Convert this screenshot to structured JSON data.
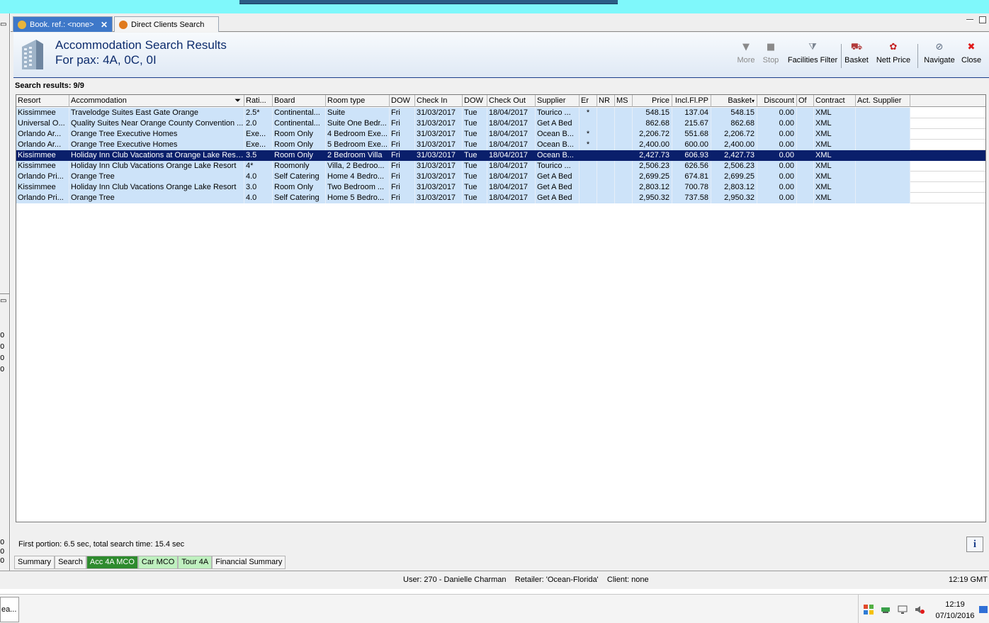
{
  "tabs": [
    {
      "label": "Book. ref.: <none>",
      "active": true
    },
    {
      "label": "Direct Clients Search",
      "active": false
    }
  ],
  "header": {
    "title": "Accommodation Search Results",
    "subtitle": "For pax: 4A, 0C, 0I"
  },
  "toolbar": {
    "more": "More",
    "stop": "Stop",
    "facilities_filter": "Facilities Filter",
    "basket": "Basket",
    "nett_price": "Nett Price",
    "navigate": "Navigate",
    "close": "Close"
  },
  "search_results_label": "Search results: 9/9",
  "columns": {
    "resort": "Resort",
    "accommodation": "Accommodation",
    "rating": "Rati...",
    "board": "Board",
    "room_type": "Room type",
    "dow_in": "DOW",
    "check_in": "Check In",
    "dow_out": "DOW",
    "check_out": "Check Out",
    "supplier": "Supplier",
    "er": "Er",
    "nr": "NR",
    "ms": "MS",
    "price": "Price",
    "incl_fl_pp": "Incl.Fl.PP",
    "basket": "Basket",
    "discount": "Discount",
    "of": "Of",
    "contract": "Contract",
    "act_supplier": "Act. Supplier"
  },
  "rows": [
    {
      "resort": "Kissimmee",
      "accommodation": "Travelodge Suites East Gate Orange",
      "rating": "2.5*",
      "board": "Continental...",
      "room_type": "Suite",
      "dow_in": "Fri",
      "check_in": "31/03/2017",
      "dow_out": "Tue",
      "check_out": "18/04/2017",
      "supplier": "Tourico ...",
      "er": "*",
      "nr": "",
      "ms": "",
      "price": "548.15",
      "incl_fl_pp": "137.04",
      "basket": "548.15",
      "discount": "0.00",
      "of": "",
      "contract": "XML",
      "act_supplier": ""
    },
    {
      "resort": "Universal O...",
      "accommodation": "Quality Suites Near Orange County Convention ...",
      "rating": "2.0",
      "board": "Continental...",
      "room_type": "Suite One Bedr...",
      "dow_in": "Fri",
      "check_in": "31/03/2017",
      "dow_out": "Tue",
      "check_out": "18/04/2017",
      "supplier": "Get A Bed",
      "er": "",
      "nr": "",
      "ms": "",
      "price": "862.68",
      "incl_fl_pp": "215.67",
      "basket": "862.68",
      "discount": "0.00",
      "of": "",
      "contract": "XML",
      "act_supplier": ""
    },
    {
      "resort": "Orlando Ar...",
      "accommodation": "Orange Tree Executive Homes",
      "rating": "Exe...",
      "board": "Room Only",
      "room_type": "4 Bedroom Exe...",
      "dow_in": "Fri",
      "check_in": "31/03/2017",
      "dow_out": "Tue",
      "check_out": "18/04/2017",
      "supplier": "Ocean B...",
      "er": "*",
      "nr": "",
      "ms": "",
      "price": "2,206.72",
      "incl_fl_pp": "551.68",
      "basket": "2,206.72",
      "discount": "0.00",
      "of": "",
      "contract": "XML",
      "act_supplier": ""
    },
    {
      "resort": "Orlando Ar...",
      "accommodation": "Orange Tree Executive Homes",
      "rating": "Exe...",
      "board": "Room Only",
      "room_type": "5 Bedroom Exe...",
      "dow_in": "Fri",
      "check_in": "31/03/2017",
      "dow_out": "Tue",
      "check_out": "18/04/2017",
      "supplier": "Ocean B...",
      "er": "*",
      "nr": "",
      "ms": "",
      "price": "2,400.00",
      "incl_fl_pp": "600.00",
      "basket": "2,400.00",
      "discount": "0.00",
      "of": "",
      "contract": "XML",
      "act_supplier": ""
    },
    {
      "resort": "Kissimmee",
      "accommodation": "Holiday Inn Club Vacations at Orange Lake Resort",
      "rating": "3.5",
      "board": "Room Only",
      "room_type": "2 Bedroom Villa",
      "dow_in": "Fri",
      "check_in": "31/03/2017",
      "dow_out": "Tue",
      "check_out": "18/04/2017",
      "supplier": "Ocean B...",
      "er": "",
      "nr": "",
      "ms": "",
      "price": "2,427.73",
      "incl_fl_pp": "606.93",
      "basket": "2,427.73",
      "discount": "0.00",
      "of": "",
      "contract": "XML",
      "act_supplier": "",
      "selected": true
    },
    {
      "resort": "Kissimmee",
      "accommodation": "Holiday Inn Club Vacations Orange Lake Resort",
      "rating": "4*",
      "board": "Roomonly",
      "room_type": "Villa, 2 Bedroo...",
      "dow_in": "Fri",
      "check_in": "31/03/2017",
      "dow_out": "Tue",
      "check_out": "18/04/2017",
      "supplier": "Tourico ...",
      "er": "",
      "nr": "",
      "ms": "",
      "price": "2,506.23",
      "incl_fl_pp": "626.56",
      "basket": "2,506.23",
      "discount": "0.00",
      "of": "",
      "contract": "XML",
      "act_supplier": ""
    },
    {
      "resort": "Orlando Pri...",
      "accommodation": "Orange Tree",
      "rating": "4.0",
      "board": "Self Catering",
      "room_type": "Home 4 Bedro...",
      "dow_in": "Fri",
      "check_in": "31/03/2017",
      "dow_out": "Tue",
      "check_out": "18/04/2017",
      "supplier": "Get A Bed",
      "er": "",
      "nr": "",
      "ms": "",
      "price": "2,699.25",
      "incl_fl_pp": "674.81",
      "basket": "2,699.25",
      "discount": "0.00",
      "of": "",
      "contract": "XML",
      "act_supplier": ""
    },
    {
      "resort": "Kissimmee",
      "accommodation": "Holiday Inn Club Vacations Orange Lake Resort",
      "rating": "3.0",
      "board": "Room Only",
      "room_type": "Two Bedroom ...",
      "dow_in": "Fri",
      "check_in": "31/03/2017",
      "dow_out": "Tue",
      "check_out": "18/04/2017",
      "supplier": "Get A Bed",
      "er": "",
      "nr": "",
      "ms": "",
      "price": "2,803.12",
      "incl_fl_pp": "700.78",
      "basket": "2,803.12",
      "discount": "0.00",
      "of": "",
      "contract": "XML",
      "act_supplier": ""
    },
    {
      "resort": "Orlando Pri...",
      "accommodation": "Orange Tree",
      "rating": "4.0",
      "board": "Self Catering",
      "room_type": "Home 5 Bedro...",
      "dow_in": "Fri",
      "check_in": "31/03/2017",
      "dow_out": "Tue",
      "check_out": "18/04/2017",
      "supplier": "Get A Bed",
      "er": "",
      "nr": "",
      "ms": "",
      "price": "2,950.32",
      "incl_fl_pp": "737.58",
      "basket": "2,950.32",
      "discount": "0.00",
      "of": "",
      "contract": "XML",
      "act_supplier": ""
    }
  ],
  "timing_text": "First portion: 6.5 sec, total search time: 15.4 sec",
  "info_button": "i",
  "bottom_tabs": [
    {
      "label": "Summary",
      "style": "plain"
    },
    {
      "label": "Search",
      "style": "plain"
    },
    {
      "label": "Acc 4A MCO",
      "style": "green-dark"
    },
    {
      "label": "Car MCO",
      "style": "green-light"
    },
    {
      "label": "Tour 4A",
      "style": "green-light"
    },
    {
      "label": "Financial Summary",
      "style": "plain"
    }
  ],
  "status": {
    "user": "User: 270 - Danielle Charman",
    "retailer": "Retailer: 'Ocean-Florida'",
    "client": "Client: none",
    "time": "12:19 GMT"
  },
  "left_panel_digits": [
    "0",
    "0",
    "0",
    "0",
    "0",
    "0",
    "0"
  ],
  "taskbar": {
    "task_label": "ea...",
    "clock_time": "12:19",
    "clock_date": "07/10/2016"
  },
  "colors": {
    "accent_blue": "#3e78c9",
    "selected_row": "#0a1f6b",
    "row_highlight": "#cde3f9",
    "tab_green_dark": "#2e8b2e",
    "tab_green_light": "#bff0bf",
    "top_strip": "#7ff8fb"
  }
}
